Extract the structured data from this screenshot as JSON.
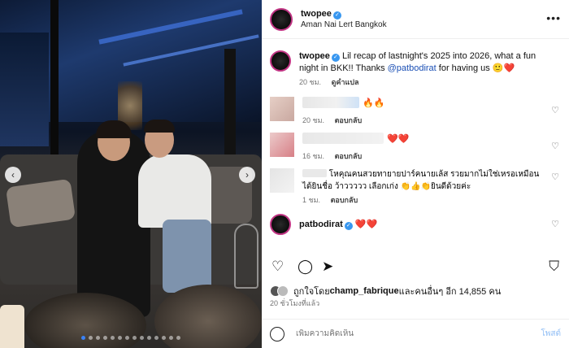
{
  "post": {
    "username": "twopee",
    "location": "Aman Nai Lert Bangkok",
    "more_label": "•••"
  },
  "caption": {
    "username": "twopee",
    "text": "Lil recap of lastnight's 2025 into 2026, what a fun night in BKK!! Thanks ",
    "mention": "@patbodirat",
    "text_after": " for having us 🙂❤️",
    "time": "20 ชม.",
    "translate": "ดูคำแปล"
  },
  "comments": [
    {
      "emoji": "🔥🔥",
      "time": "20 ชม.",
      "reply": "ตอบกลับ"
    },
    {
      "emoji": "❤️❤️",
      "time": "16 ชม.",
      "reply": "ตอบกลับ"
    },
    {
      "text": "โหคุณคนสวยทายายปาร์คนายเล้ส รวยมากไม่ใช่เหรอเหมือนได้ยินชื่อ ว้าววววว เลือกเก่ง 👏👍👏ยินดีด้วยค่ะ",
      "time": "1 ชม.",
      "reply": "ตอบกลับ"
    },
    {
      "username": "patbodirat",
      "emoji": "❤️❤️"
    }
  ],
  "likes": {
    "prefix": "ถูกใจโดย ",
    "user": "champ_fabrique",
    "suffix": " และคนอื่นๆ อีก 14,855 คน"
  },
  "time_ago": "20 ชั่วโมงที่แล้ว",
  "add_comment": {
    "placeholder": "เพิ่มความคิดเห็น",
    "post_label": "โพสต์"
  },
  "carousel": {
    "total_slides": 14,
    "active_index": 0
  },
  "colors": {
    "link": "#1a4fb5",
    "verified": "#3897f0",
    "post_button": "#8fbdf5"
  }
}
